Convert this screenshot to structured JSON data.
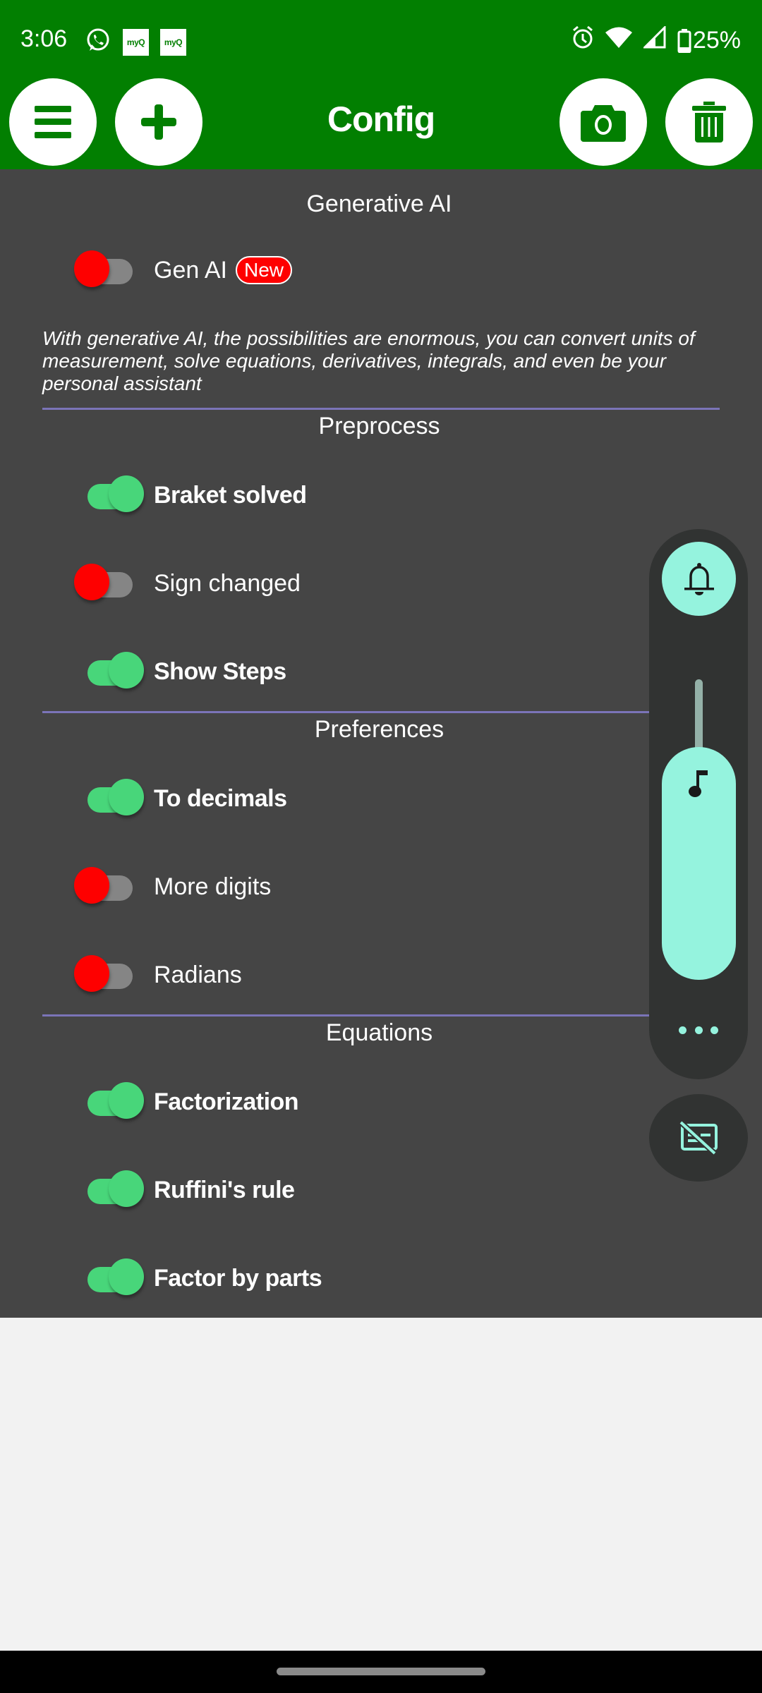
{
  "status_bar": {
    "time": "3:06",
    "notification_icons": [
      "whatsapp-icon",
      "myq-icon",
      "myq-icon"
    ],
    "myq_label": "myQ",
    "system_icons": [
      "alarm-icon",
      "wifi-icon",
      "signal-icon",
      "battery-icon"
    ],
    "battery": "25%"
  },
  "app_bar": {
    "title": "Config",
    "buttons": [
      "menu",
      "add",
      "camera",
      "delete"
    ],
    "colors": {
      "primary": "#027f01",
      "button_bg": "#ffffff"
    }
  },
  "sections": [
    {
      "title": "Generative AI",
      "items": [
        {
          "label": "Gen AI",
          "enabled": false,
          "badge": "New"
        }
      ],
      "description": "With generative AI, the possibilities are enormous, you can convert units of measurement, solve equations, derivatives, integrals, and even be your personal assistant"
    },
    {
      "title": "Preprocess",
      "items": [
        {
          "label": "Braket solved",
          "enabled": true
        },
        {
          "label": "Sign changed",
          "enabled": false
        },
        {
          "label": "Show Steps",
          "enabled": true
        }
      ]
    },
    {
      "title": "Preferences",
      "items": [
        {
          "label": "To decimals",
          "enabled": true
        },
        {
          "label": "More digits",
          "enabled": false
        },
        {
          "label": "Radians",
          "enabled": false
        }
      ]
    },
    {
      "title": "Equations",
      "items": [
        {
          "label": "Factorization",
          "enabled": true
        },
        {
          "label": "Ruffini's rule",
          "enabled": true
        },
        {
          "label": "Factor by parts",
          "enabled": true
        }
      ]
    }
  ],
  "toggle_colors": {
    "on": "#48d67a",
    "off_thumb": "#fe0000",
    "off_track": "#858585"
  },
  "volume_overlay": {
    "ringer_mode": "bell-icon",
    "stream": "media",
    "level_percent": 80,
    "accent": "#95f3de"
  }
}
